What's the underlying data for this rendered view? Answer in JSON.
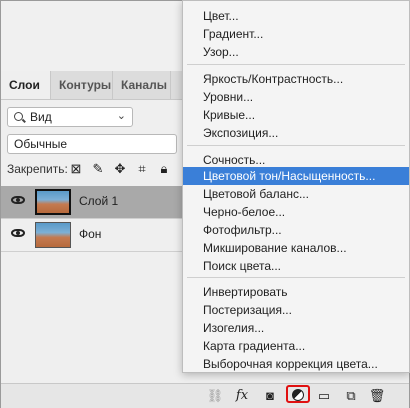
{
  "panel": {
    "tabs": [
      "Слои",
      "Контуры",
      "Каналы"
    ],
    "filter_label": "Вид",
    "blend_mode": "Обычные",
    "lock_label": "Закрепить:",
    "layers": [
      {
        "name": "Слой 1",
        "selected": true
      },
      {
        "name": "Фон",
        "selected": false
      }
    ]
  },
  "bottom_bar": {
    "fx_label": "fx"
  },
  "menu": {
    "items": [
      "Цвет...",
      "Градиент...",
      "Узор...",
      "Яркость/Контрастность...",
      "Уровни...",
      "Кривые...",
      "Экспозиция...",
      "Сочность...",
      "Цветовой тон/Насыщенность...",
      "Цветовой баланс...",
      "Черно-белое...",
      "Фотофильтр...",
      "Микширование каналов...",
      "Поиск цвета...",
      "Инвертировать",
      "Постеризация...",
      "Изогелия...",
      "Карта градиента...",
      "Выборочная коррекция цвета..."
    ],
    "highlighted": "Цветовой тон/Насыщенность..."
  },
  "colors": {
    "highlight": "#3a7fd8",
    "selected_layer": "#a9a9a9",
    "adjustment_button_outline": "#e01010"
  }
}
